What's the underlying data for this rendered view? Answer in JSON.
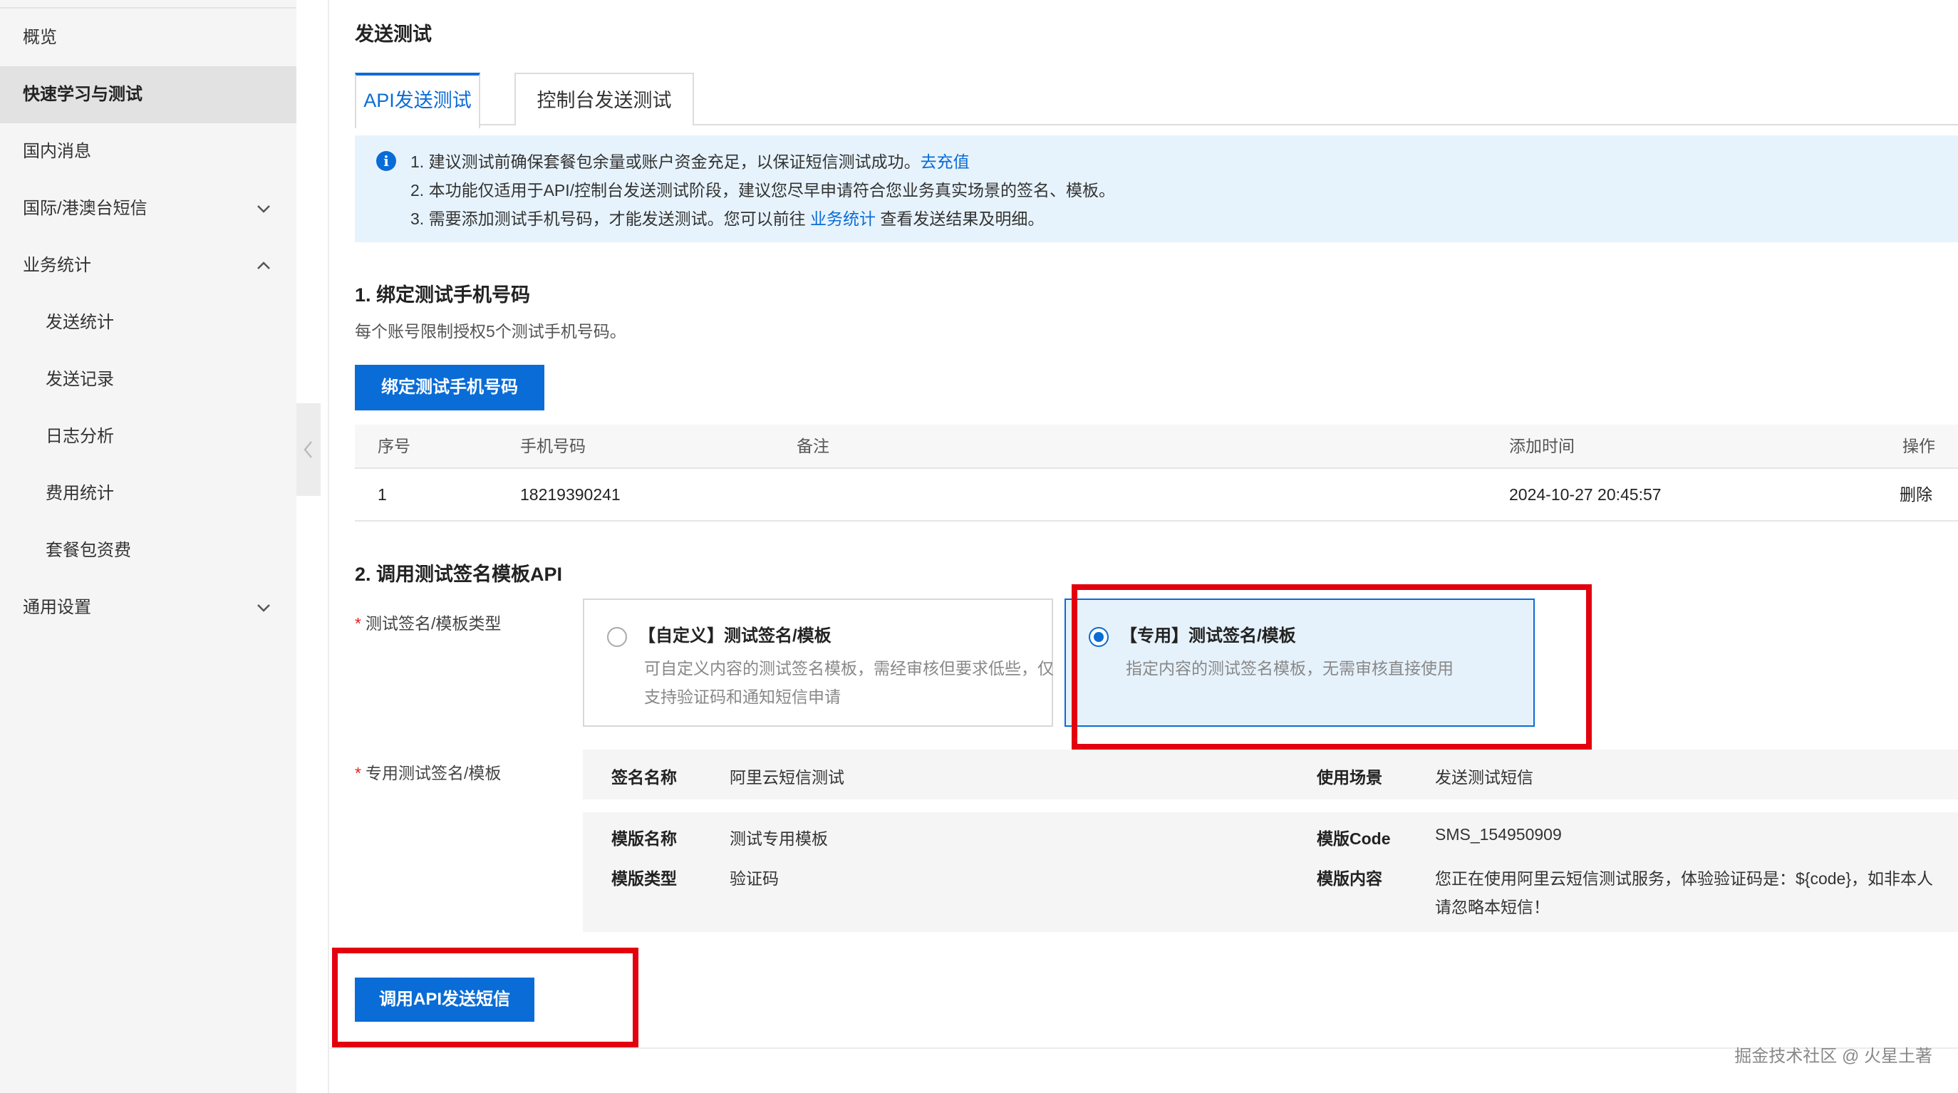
{
  "sidebar": {
    "items": [
      {
        "label": "概览"
      },
      {
        "label": "快速学习与测试"
      },
      {
        "label": "国内消息"
      },
      {
        "label": "国际/港澳台短信"
      },
      {
        "label": "业务统计"
      },
      {
        "label": "发送统计"
      },
      {
        "label": "发送记录"
      },
      {
        "label": "日志分析"
      },
      {
        "label": "费用统计"
      },
      {
        "label": "套餐包资费"
      },
      {
        "label": "通用设置"
      }
    ]
  },
  "page": {
    "title": "发送测试"
  },
  "tabs": [
    {
      "label": "API发送测试",
      "active": true
    },
    {
      "label": "控制台发送测试",
      "active": false
    }
  ],
  "notice": {
    "line1": "1. 建议测试前确保套餐包余量或账户资金充足，以保证短信测试成功。",
    "line1_link": "去充值",
    "line2": "2. 本功能仅适用于API/控制台发送测试阶段，建议您尽早申请符合您业务真实场景的签名、模板。",
    "line3_pre": "3. 需要添加测试手机号码，才能发送测试。您可以前往 ",
    "line3_link": "业务统计",
    "line3_post": " 查看发送结果及明细。"
  },
  "section1": {
    "title": "1. 绑定测试手机号码",
    "desc": "每个账号限制授权5个测试手机号码。",
    "button": "绑定测试手机号码"
  },
  "table": {
    "headers": [
      "序号",
      "手机号码",
      "备注",
      "添加时间",
      "操作"
    ],
    "rows": [
      {
        "index": "1",
        "phone": "18219390241",
        "note": "",
        "time": "2024-10-27 20:45:57",
        "action": "删除"
      }
    ]
  },
  "section2": {
    "title": "2. 调用测试签名模板API",
    "type_label": "测试签名/模板类型",
    "option_custom_title": "【自定义】测试签名/模板",
    "option_custom_desc": "可自定义内容的测试签名模板，需经审核但要求低些，仅支持验证码和通知短信申请",
    "option_dedicated_title": "【专用】测试签名/模板",
    "option_dedicated_desc": "指定内容的测试签名模板，无需审核直接使用",
    "dedicated_label": "专用测试签名/模板",
    "sign_name_key": "签名名称",
    "sign_name_val": "阿里云短信测试",
    "scene_key": "使用场景",
    "scene_val": "发送测试短信",
    "tpl_name_key": "模版名称",
    "tpl_name_val": "测试专用模板",
    "tpl_code_key": "模版Code",
    "tpl_code_val": "SMS_154950909",
    "tpl_type_key": "模版类型",
    "tpl_type_val": "验证码",
    "tpl_content_key": "模版内容",
    "tpl_content_line1": "您正在使用阿里云短信测试服务，体验验证码是：${code}，如非本人",
    "tpl_content_line2": "请忽略本短信！",
    "send_button": "调用API发送短信"
  },
  "watermark": "掘金技术社区 @ 火星土著",
  "colors": {
    "accent": "#0a6cd6",
    "highlight_box": "#e3000f",
    "notice_bg": "#e7f3fc"
  }
}
